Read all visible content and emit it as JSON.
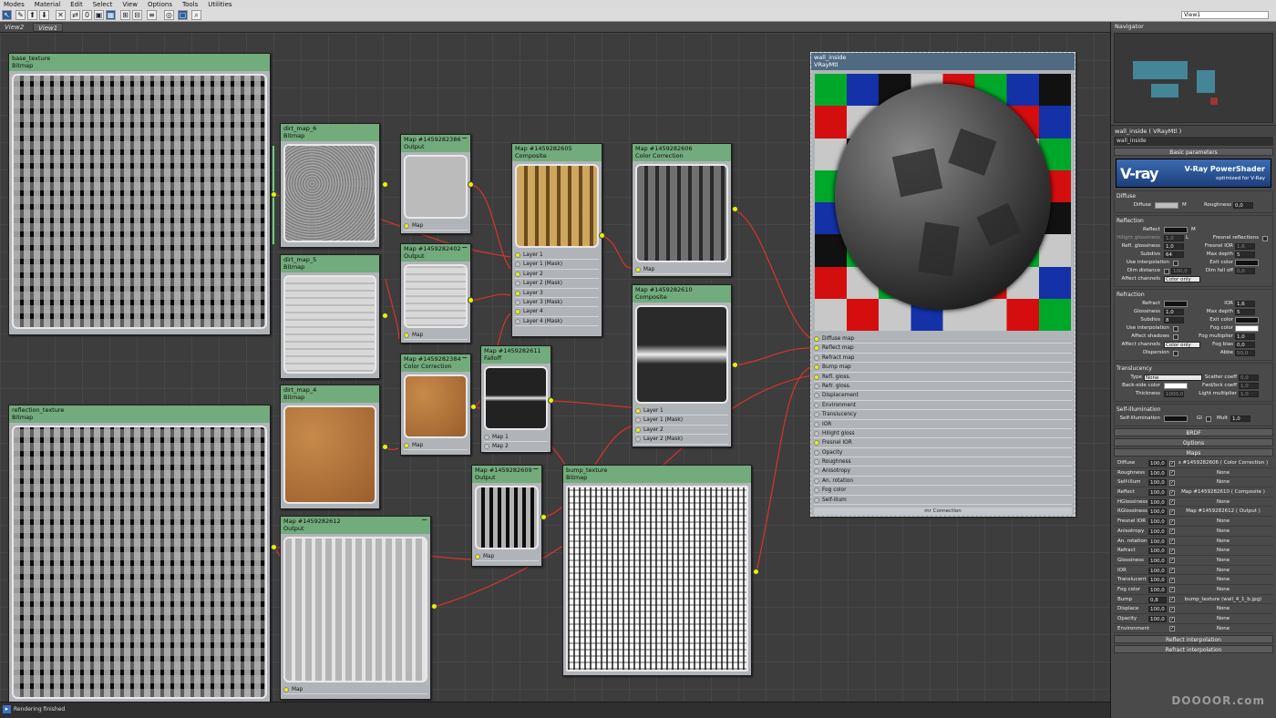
{
  "menu": [
    "Modes",
    "Material",
    "Edit",
    "Select",
    "View",
    "Options",
    "Tools",
    "Utilities"
  ],
  "toolbar": {
    "view_selector": "View1"
  },
  "view_tabs": [
    "View2",
    "View1"
  ],
  "status": {
    "text": "Rendering finished"
  },
  "nodes": {
    "base_texture": {
      "title": "base_texture",
      "type": "Bitmap"
    },
    "reflection_texture": {
      "title": "reflection_texture",
      "type": "Bitmap"
    },
    "dirt6": {
      "title": "dirt_map_6",
      "type": "Bitmap"
    },
    "dirt5": {
      "title": "dirt_map_5",
      "type": "Bitmap"
    },
    "dirt4": {
      "title": "dirt_map_4",
      "type": "Bitmap"
    },
    "m386": {
      "title": "Map #1459282386",
      "type": "Output",
      "slot": "Map"
    },
    "m402": {
      "title": "Map #1459282402",
      "type": "Output",
      "slot": "Map"
    },
    "m384": {
      "title": "Map #1459282384",
      "type": "Color Correction",
      "slot": "Map"
    },
    "m605": {
      "title": "Map #1459282605",
      "type": "Composite",
      "slots": [
        "Layer 1",
        "Layer 1 (Mask)",
        "Layer 2",
        "Layer 2 (Mask)",
        "Layer 3",
        "Layer 3 (Mask)",
        "Layer 4",
        "Layer 4 (Mask)"
      ]
    },
    "m611": {
      "title": "Map #1459282611",
      "type": "Falloff",
      "slots": [
        "Map 1",
        "Map 2"
      ]
    },
    "m606": {
      "title": "Map #1459282606",
      "type": "Color Correction",
      "slot": "Map"
    },
    "m610": {
      "title": "Map #1459282610",
      "type": "Composite",
      "slots": [
        "Layer 1",
        "Layer 1 (Mask)",
        "Layer 2",
        "Layer 2 (Mask)"
      ]
    },
    "m609": {
      "title": "Map #1459282609",
      "type": "Output",
      "slot": "Map"
    },
    "m612": {
      "title": "Map #1459282612",
      "type": "Output",
      "slot": "Map"
    },
    "bump": {
      "title": "bump_texture",
      "type": "Bitmap"
    },
    "wall": {
      "title": "wall_inside",
      "type": "VRayMtl",
      "footer": "mr Connection",
      "slots": [
        "Diffuse map",
        "Reflect map",
        "Refract map",
        "Bump map",
        "Refl. gloss.",
        "Refr. gloss.",
        "Displacement",
        "Environment",
        "Translucency",
        "IOR",
        "Hilight gloss",
        "Fresnel IOR",
        "Opacity",
        "Roughness",
        "Anisotropy",
        "An. rotation",
        "Fog color",
        "Self-illum"
      ]
    }
  },
  "panel": {
    "navigator": "Navigator",
    "header": "wall_inside  ( VRayMtl )",
    "name": "wall_inside",
    "basic": "Basic parameters",
    "logo_brand": "V-ray",
    "logo_title": "V-Ray PowerShader",
    "logo_sub": "optimized for V-Ray",
    "diffuse": {
      "group": "Diffuse",
      "label": "Diffuse",
      "m": "M",
      "rough_label": "Roughness",
      "rough": "0,0"
    },
    "reflection": {
      "group": "Reflection",
      "reflect": "Reflect",
      "m": "M",
      "hgloss": "Hilight glossiness",
      "hgloss_v": "1,0",
      "l": "L",
      "fresnel": "Fresnel reflections",
      "rgloss": "Refl. glossiness",
      "rgloss_v": "1,0",
      "fior": "Fresnel IOR",
      "fior_v": "1,6",
      "subdivs": "Subdivs",
      "subdivs_v": "64",
      "maxdepth": "Max depth",
      "maxdepth_v": "5",
      "interp": "Use interpolation",
      "exitc": "Exit color",
      "dimd": "Dim distance",
      "dimd_v": "100,0",
      "dimf": "Dim fall off",
      "dimf_v": "0,0",
      "affect": "Affect channels",
      "affect_v": "Color only"
    },
    "refraction": {
      "group": "Refraction",
      "refract": "Refract",
      "ior": "IOR",
      "ior_v": "1,6",
      "gloss": "Glossiness",
      "gloss_v": "1,0",
      "maxd": "Max depth",
      "maxd_v": "5",
      "subdivs": "Subdivs",
      "subdivs_v": "8",
      "exitc": "Exit color",
      "interp": "Use interpolation",
      "fogc": "Fog color",
      "shadows": "Affect shadows",
      "fogm": "Fog multiplier",
      "fogm_v": "1,0",
      "affect": "Affect channels",
      "affect_v": "Color only",
      "fogb": "Fog bias",
      "fogb_v": "0,0",
      "disp": "Dispersion",
      "abbe": "Abbe",
      "abbe_v": "50,0"
    },
    "translucency": {
      "group": "Translucency",
      "type": "Type",
      "type_v": "None",
      "scatter": "Scatter coeff",
      "scatter_v": "0,0",
      "back": "Back-side color",
      "fwd": "Fwd/bck coeff",
      "fwd_v": "1,0",
      "thick": "Thickness",
      "thick_v": "1000,0",
      "light": "Light multiplier",
      "light_v": "1,0"
    },
    "selfillum": {
      "group": "Self-illumination",
      "label": "Self-illumination",
      "gi": "GI",
      "mult": "Mult",
      "mult_v": "1,0"
    },
    "brdf": "BRDF",
    "options": "Options",
    "maps": "Maps",
    "map_rows": [
      {
        "name": "Diffuse",
        "val": "100,0",
        "map": "s #1459282606  ( Color Correction )"
      },
      {
        "name": "Roughness",
        "val": "100,0",
        "map": "None"
      },
      {
        "name": "Self-illum",
        "val": "100,0",
        "map": "None"
      },
      {
        "name": "Reflect",
        "val": "100,0",
        "map": "Map #1459282610  ( Composite )"
      },
      {
        "name": "HGlossiness",
        "val": "100,0",
        "map": "None"
      },
      {
        "name": "RGlossiness",
        "val": "100,0",
        "map": "Map #1459282612  ( Output )"
      },
      {
        "name": "Fresnel IOR",
        "val": "100,0",
        "map": "None"
      },
      {
        "name": "Anisotropy",
        "val": "100,0",
        "map": "None"
      },
      {
        "name": "An. rotation",
        "val": "100,0",
        "map": "None"
      },
      {
        "name": "Refract",
        "val": "100,0",
        "map": "None"
      },
      {
        "name": "Glossiness",
        "val": "100,0",
        "map": "None"
      },
      {
        "name": "IOR",
        "val": "100,0",
        "map": "None"
      },
      {
        "name": "Translucent",
        "val": "100,0",
        "map": "None"
      },
      {
        "name": "Fog color",
        "val": "100,0",
        "map": "None"
      },
      {
        "name": "Bump",
        "val": "0,8",
        "map": "bump_texture (wall_4_1_b.jpg)"
      },
      {
        "name": "Displace",
        "val": "100,0",
        "map": "None"
      },
      {
        "name": "Opacity",
        "val": "100,0",
        "map": "None"
      },
      {
        "name": "Environment",
        "val": "",
        "map": "None"
      }
    ],
    "refl_interp": "Reflect interpolation",
    "refr_interp": "Refract interpolation"
  },
  "watermark": "DOOOOR.com",
  "colors": {
    "node_header": "#72ab7c",
    "wire": "#d9332b",
    "socket": "#e8f20a",
    "material_header": "#506a82"
  }
}
